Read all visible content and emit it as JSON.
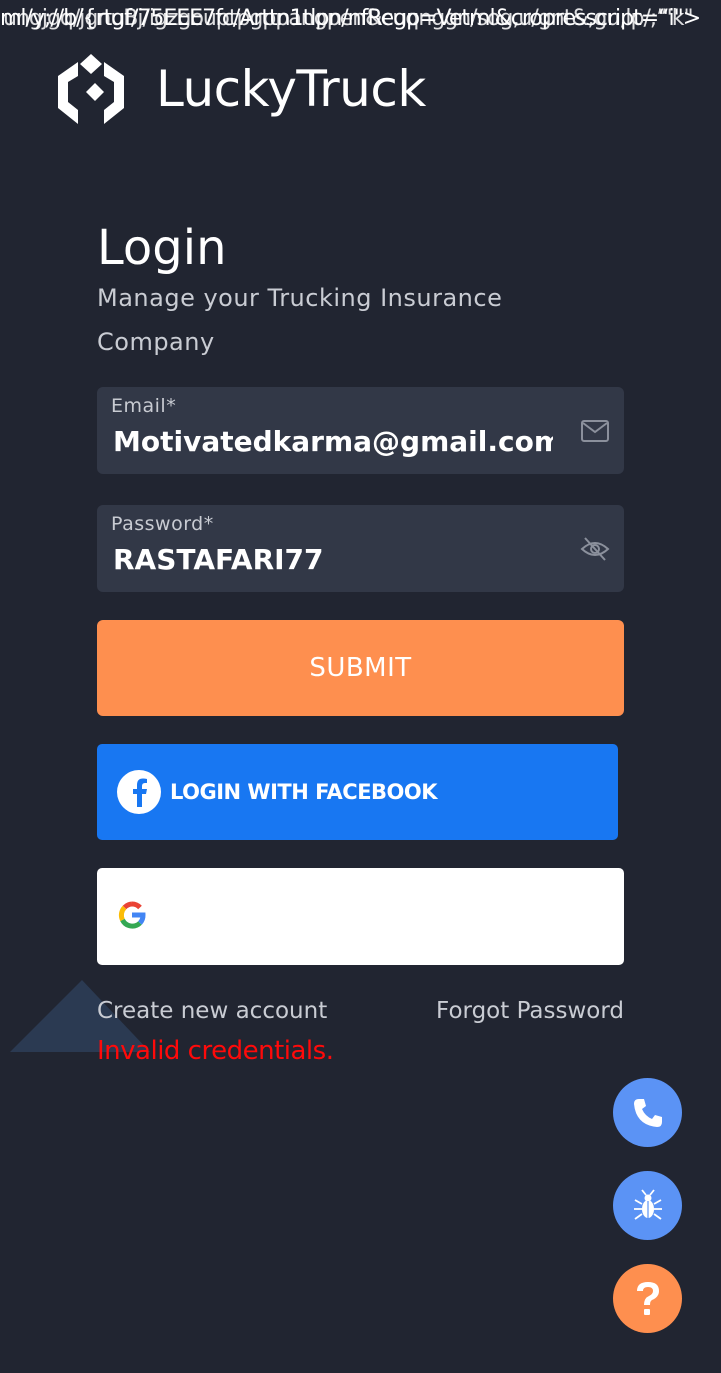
{
  "stray_text": {
    "line1": "ml/y;//b/{rtgf/75EEE7fc/Arttn1tlpn/nfRegp=Vetml&cropresscript=“i\">",
    "line2": "ungjgq/jgnuBj/igzgouptpgppangpen&cuqnggn/sog,u/gnt&,gu,lp/;”'k\""
  },
  "brand": {
    "name": "LuckyTruck"
  },
  "login": {
    "title": "Login",
    "subtitle": "Manage your Trucking Insurance Company"
  },
  "email": {
    "label": "Email*",
    "value": "Motivatedkarma@gmail.com",
    "icon": "mail-icon"
  },
  "password": {
    "label": "Password*",
    "value": "RASTAFARI77",
    "icon": "eye-off-icon"
  },
  "buttons": {
    "submit": "SUBMIT",
    "facebook": "LOGIN WITH FACEBOOK",
    "google": ""
  },
  "links": {
    "create_account": "Create new account",
    "forgot_password": "Forgot Password"
  },
  "error": "Invalid credentials.",
  "colors": {
    "background": "#212531",
    "field": "#323847",
    "accent_orange": "#fe8f4f",
    "facebook_blue": "#1877f2",
    "fab_blue": "#5b93f5",
    "error_red": "#ff0a0a"
  },
  "fabs": [
    {
      "name": "call",
      "icon": "phone-icon"
    },
    {
      "name": "report-bug",
      "icon": "bug-icon"
    },
    {
      "name": "help",
      "icon": "question-icon"
    }
  ]
}
